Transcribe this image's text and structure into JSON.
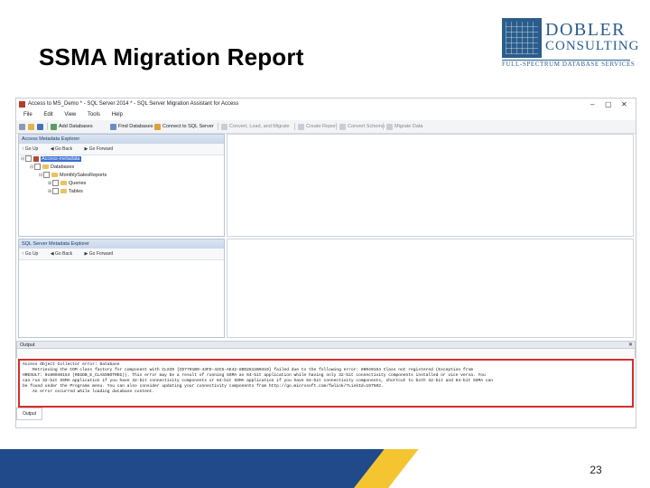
{
  "slide": {
    "title": "SSMA Migration Report",
    "page_number": "23"
  },
  "logo": {
    "name": "DOBLER",
    "sub": "CONSULTING",
    "tagline": "FULL-SPECTRUM DATABASE SERVICES"
  },
  "app": {
    "window_title": "Access to MS_Demo * - SQL Server 2014 * - SQL Server Migration Assistant for Access",
    "window_controls": [
      "–",
      "▢",
      "✕"
    ],
    "menu": [
      "File",
      "Edit",
      "View",
      "Tools",
      "Help"
    ],
    "toolbar": [
      "Add Databases",
      "Find Databases",
      "Connect to SQL Server",
      "Convert, Load, and Migrate",
      "Create Report",
      "Convert Schema",
      "Migrate Data"
    ],
    "access_panel": {
      "title": "Access Metadata Explorer",
      "nav": [
        "Go Up",
        "Go Back",
        "Go Forward"
      ],
      "tree": [
        {
          "label": "Access-metadata",
          "level": 0,
          "selected": true
        },
        {
          "label": "Databases",
          "level": 1
        },
        {
          "label": "MonthlySalesReports",
          "level": 2
        },
        {
          "label": "Queries",
          "level": 3
        },
        {
          "label": "Tables",
          "level": 3
        }
      ]
    },
    "sql_panel": {
      "title": "SQL Server Metadata Explorer",
      "nav": [
        "Go Up",
        "Go Back",
        "Go Forward"
      ]
    },
    "output": {
      "title": "Output",
      "close": "✕",
      "lines": [
        "Access Object Collector error: Database",
        "    Retrieving the COM class factory for component with CLSID {CD7791B9-43FD-42C5-AE42-8DD2811B0419} failed due to the following error: 80040154 Class not registered (Exception from",
        "HRESULT: 0x80040154 (REGDB_E_CLASSNOTREG)). This error may be a result of running SSMA as 64-bit application while having only 32-bit connectivity components installed or vice versa. You",
        "can run 32-bit SSMA application if you have 32-bit connectivity components or 64-bit SSMA application if you have 64-bit connectivity components, shortcut to both 32-bit and 64-bit SSMA can",
        "be found under the Programs menu. You can also consider updating your connectivity components from http://go.microsoft.com/fwlink/?LinkId=197502.",
        "    An error occurred while loading database content."
      ],
      "status_tab": "Output"
    }
  }
}
